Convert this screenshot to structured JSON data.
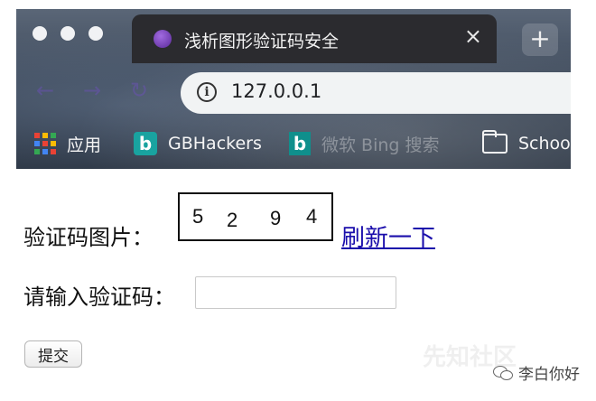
{
  "browser": {
    "tab": {
      "title": "浅析图形验证码安全",
      "close": "×"
    },
    "new_tab": "+",
    "toolbar": {
      "back": "←",
      "forward": "→",
      "reload": "↻",
      "info": "i",
      "url": "127.0.0.1"
    },
    "bookmarks": [
      {
        "label": "应用",
        "icon": "apps-grid-icon"
      },
      {
        "label": "GBHackers",
        "icon": "gbhackers-icon"
      },
      {
        "label": "微软 Bing 搜索",
        "icon": "bing-icon"
      },
      {
        "label": "Schoo",
        "icon": "folder-icon"
      }
    ]
  },
  "page": {
    "captcha_label": "验证码图片：",
    "captcha_digits": [
      "5",
      "2",
      "9",
      "4"
    ],
    "refresh_link": "刷新一下",
    "input_label": "请输入验证码：",
    "input_value": "",
    "submit_label": "提交"
  },
  "overlay": {
    "watermark": "先知社区",
    "wechat_account": "李白你好"
  },
  "colors": {
    "link": "#1a0dab",
    "tab_bg": "#2b2b2f",
    "omnibox_bg": "#f1f3f4"
  }
}
